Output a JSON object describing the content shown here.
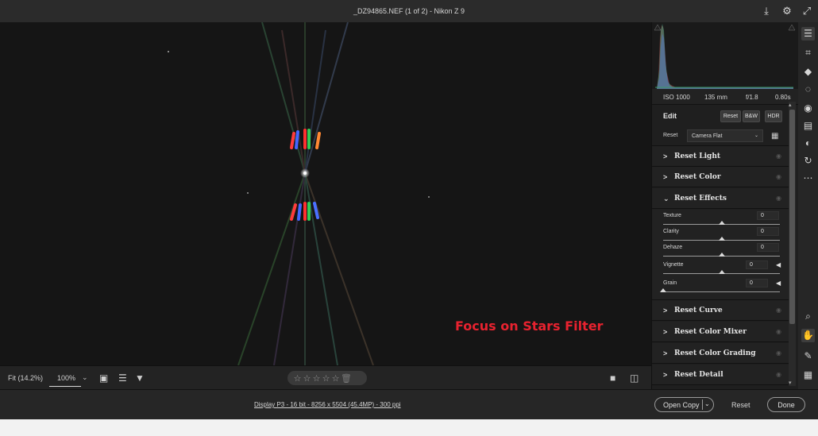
{
  "window": {
    "title": "_DZ94865.NEF (1 of 2)  -  Nikon Z 9"
  },
  "canvas": {
    "overlay_text": "Focus on Stars Filter"
  },
  "canvas_toolbar": {
    "zoom_fit": "Fit (14.2%)",
    "zoom_level": "100%",
    "rating_stars": [
      "☆",
      "☆",
      "☆",
      "☆",
      "☆"
    ],
    "rating_value": 0,
    "trash": "🗑"
  },
  "exif": {
    "iso": "ISO 1000",
    "focal": "135 mm",
    "aperture": "f/1.8",
    "shutter": "0.80s"
  },
  "edit": {
    "title": "Edit",
    "reset_btn": "Reset",
    "bw_btn": "B&W",
    "hdr_btn": "HDR",
    "profile_label": "Reset",
    "profile_value": "Camera Flat"
  },
  "sections": {
    "light": "Reset Light",
    "color": "Reset Color",
    "effects": "Reset Effects",
    "curve": "Reset Curve",
    "mixer": "Reset Color Mixer",
    "grading": "Reset Color Grading",
    "detail": "Reset Detail"
  },
  "effects": {
    "texture": {
      "label": "Texture",
      "value": "0",
      "level": 0.5
    },
    "clarity": {
      "label": "Clarity",
      "value": "0",
      "level": 0.5
    },
    "dehaze": {
      "label": "Dehaze",
      "value": "0",
      "level": 0.5
    },
    "vignette": {
      "label": "Vignette",
      "value": "0",
      "level": 0.5
    },
    "grain": {
      "label": "Grain",
      "value": "0",
      "level": 0.0
    }
  },
  "status": {
    "info": "Display P3 - 16 bit - 8256 x 5504 (45.4MP) - 300 ppi",
    "open_copy": "Open Copy",
    "reset": "Reset",
    "done": "Done"
  },
  "icons": {
    "chevron_right": ">",
    "chevron_down": "⌄",
    "eye": "◉",
    "flag": "◀"
  },
  "colors": {
    "accent_red": "#e8222f",
    "panel_bg": "#1f1f1f"
  }
}
